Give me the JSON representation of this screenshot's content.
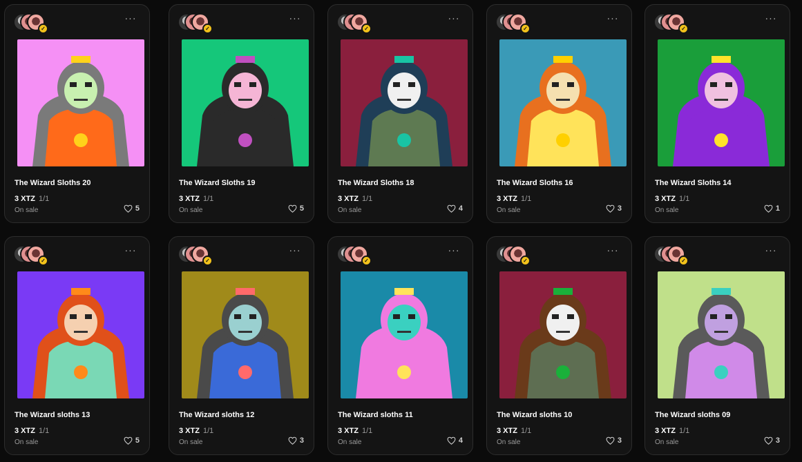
{
  "currency_price": "3 XTZ",
  "edition": "1/1",
  "status": "On sale",
  "more_label": "···",
  "cards": [
    {
      "title": "The Wizard Sloths 20",
      "price": "3 XTZ",
      "edition": "1/1",
      "status": "On sale",
      "likes": "5",
      "bg": "#f590f5",
      "fur": "#7a7a7a",
      "face": "#c8f0b0",
      "outfit": "#ff6a1a",
      "accent": "#ffd21a",
      "icon": "astronaut-sloth"
    },
    {
      "title": "The Wizard Sloths 19",
      "price": "3 XTZ",
      "edition": "1/1",
      "status": "On sale",
      "likes": "5",
      "bg": "#15c77a",
      "fur": "#2a2a2a",
      "face": "#f5b5d5",
      "outfit": "#2a2a2a",
      "accent": "#c050c0",
      "icon": "hooded-sloth"
    },
    {
      "title": "The Wizard Sloths 18",
      "price": "3 XTZ",
      "edition": "1/1",
      "status": "On sale",
      "likes": "4",
      "bg": "#8a1f3d",
      "fur": "#1f3e57",
      "face": "#f0f0f0",
      "outfit": "#5e7a52",
      "accent": "#19c4a4",
      "icon": "snorkel-sloth"
    },
    {
      "title": "The Wizard Sloths 16",
      "price": "3 XTZ",
      "edition": "1/1",
      "status": "On sale",
      "likes": "3",
      "bg": "#3a9ab7",
      "fur": "#e8701f",
      "face": "#f5e0b0",
      "outfit": "#ffe35a",
      "accent": "#ffd000",
      "icon": "king-sloth"
    },
    {
      "title": "The Wizard Sloths 14",
      "price": "3 XTZ",
      "edition": "1/1",
      "status": "On sale",
      "likes": "1",
      "bg": "#1a9e3a",
      "fur": "#8a2ad8",
      "face": "#f0c0e0",
      "outfit": "#8a2ad8",
      "accent": "#ffe32a",
      "icon": "tie-sloth"
    },
    {
      "title": "The Wizard sloths 13",
      "price": "3 XTZ",
      "edition": "1/1",
      "status": "On sale",
      "likes": "5",
      "bg": "#7a3af5",
      "fur": "#e0501a",
      "face": "#f5d0b0",
      "outfit": "#7ad8b5",
      "accent": "#ff8a1a",
      "icon": "wizard-hat-sloth"
    },
    {
      "title": "The Wizard sloths 12",
      "price": "3 XTZ",
      "edition": "1/1",
      "status": "On sale",
      "likes": "3",
      "bg": "#a08a1a",
      "fur": "#4a4a4a",
      "face": "#9ad0d0",
      "outfit": "#3a6ad8",
      "accent": "#ff6a6a",
      "icon": "overalls-sloth"
    },
    {
      "title": "The Wizard sloths 11",
      "price": "3 XTZ",
      "edition": "1/1",
      "status": "On sale",
      "likes": "4",
      "bg": "#1a8aa8",
      "fur": "#f07ae0",
      "face": "#3ad0c0",
      "outfit": "#f07ae0",
      "accent": "#ffe35a",
      "icon": "pink-hood-sloth"
    },
    {
      "title": "The Wizard sloths 10",
      "price": "3 XTZ",
      "edition": "1/1",
      "status": "On sale",
      "likes": "3",
      "bg": "#8a1f3d",
      "fur": "#6a3a1a",
      "face": "#f0f0f0",
      "outfit": "#5e6e52",
      "accent": "#1ab03a",
      "icon": "rasta-hat-sloth"
    },
    {
      "title": "The Wizard sloths 09",
      "price": "3 XTZ",
      "edition": "1/1",
      "status": "On sale",
      "likes": "3",
      "bg": "#c0e08a",
      "fur": "#5a5a5a",
      "face": "#c0a0e0",
      "outfit": "#d08ae8",
      "accent": "#3ad0c0",
      "icon": "purple-sloth"
    }
  ]
}
